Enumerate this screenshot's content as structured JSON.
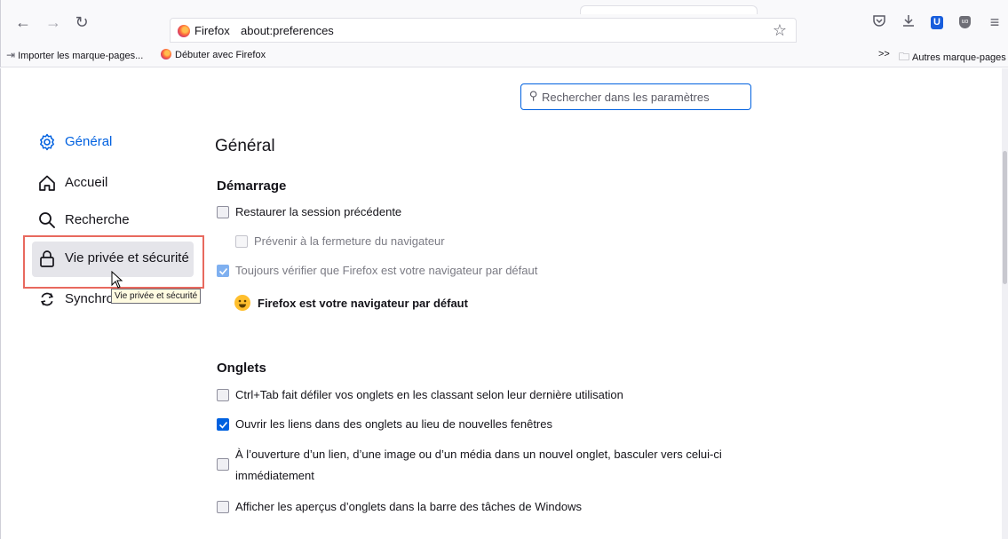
{
  "browser": {
    "url_identity": "Firefox",
    "url": "about:preferences"
  },
  "bookmarks": {
    "import": "Importer les marque-pages...",
    "getting_started": "Débuter avec Firefox",
    "overflow": ">>",
    "other": "Autres marque-pages"
  },
  "search": {
    "placeholder": "Rechercher dans les paramètres"
  },
  "sidebar": {
    "items": [
      {
        "label": "Général"
      },
      {
        "label": "Accueil"
      },
      {
        "label": "Recherche"
      },
      {
        "label": "Vie privée et sécurité"
      },
      {
        "label": "Synchro"
      }
    ],
    "tooltip": "Vie privée et sécurité"
  },
  "main": {
    "title": "Général",
    "startup": {
      "heading": "Démarrage",
      "restore_session": "Restaurer la session précédente",
      "warn_on_close": "Prévenir à la fermeture du navigateur",
      "check_default": "Toujours vérifier que Firefox est votre navigateur par défaut",
      "is_default": "Firefox est votre navigateur par défaut"
    },
    "tabs": {
      "heading": "Onglets",
      "ctrl_tab": "Ctrl+Tab fait défiler vos onglets en les classant selon leur dernière utilisation",
      "open_links_in_tabs": "Ouvrir les liens dans des onglets au lieu de nouvelles fenêtres",
      "switch_to_new_tab_line1": "À l’ouverture d’un lien, d’une image ou d’un média dans un nouvel onglet, basculer vers celui-ci",
      "switch_to_new_tab_line2": "immédiatement",
      "taskbar_previews": "Afficher les aperçus d’onglets dans la barre des tâches de Windows"
    }
  },
  "colors": {
    "accent": "#0061e0",
    "highlight_box": "#e8695e"
  }
}
